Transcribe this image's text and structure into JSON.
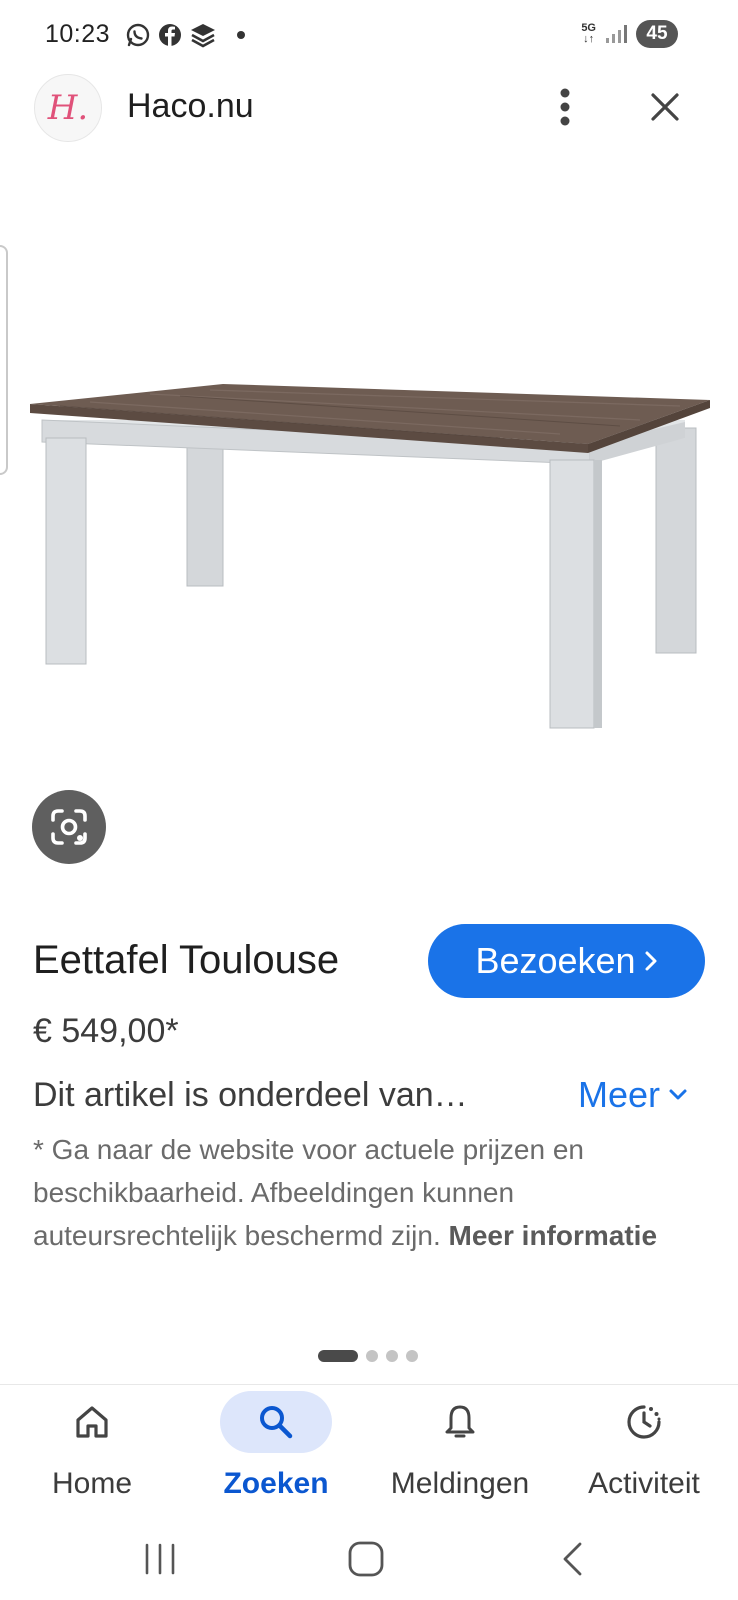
{
  "status_bar": {
    "time": "10:23",
    "network": "5G",
    "battery": "45",
    "app_icons": [
      "whatsapp-icon",
      "facebook-icon",
      "stack-icon"
    ]
  },
  "header": {
    "logo_text": "H.",
    "site_name": "Haco.nu"
  },
  "product": {
    "title": "Eettafel Toulouse",
    "visit_label": "Bezoeken",
    "price": "€ 549,00*",
    "description": "Dit artikel is onderdeel van…",
    "more_label": "Meer",
    "disclaimer": "* Ga naar de website voor actuele prijzen en beschikbaarheid. Afbeeldingen kunnen auteursrechtelijk beschermd zijn.",
    "more_info_label": "Meer informatie"
  },
  "pager": {
    "total": 4,
    "active": 1
  },
  "bottom_nav": {
    "items": [
      {
        "label": "Home",
        "icon": "home-icon",
        "active": false
      },
      {
        "label": "Zoeken",
        "icon": "search-icon",
        "active": true
      },
      {
        "label": "Meldingen",
        "icon": "bell-icon",
        "active": false
      },
      {
        "label": "Activiteit",
        "icon": "activity-icon",
        "active": false
      }
    ]
  },
  "colors": {
    "accent": "#1a73e8",
    "active_nav": "#0b57d0",
    "active_nav_bg": "#dde6fb",
    "logo": "#e0527a",
    "table_top": "#6b5a50",
    "table_legs": "#d9dcdf"
  }
}
